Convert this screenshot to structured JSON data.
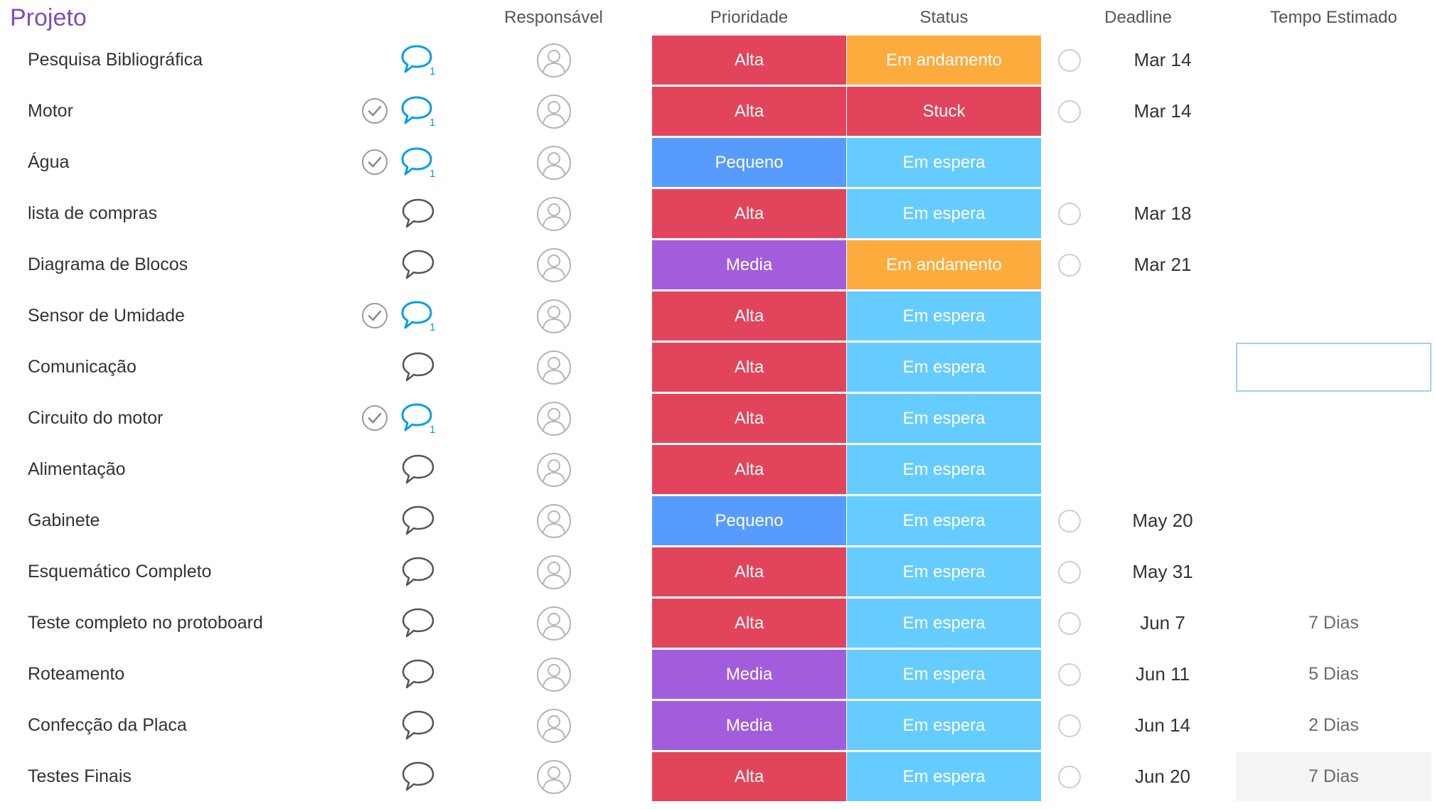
{
  "header": {
    "group_title": "Projeto",
    "columns": [
      "Responsável",
      "Prioridade",
      "Status",
      "Deadline",
      "Tempo Estimado"
    ]
  },
  "colors": {
    "alta": "#e2445c",
    "pequeno": "#579bfc",
    "media": "#a25ddc",
    "em_andamento": "#fdab3d",
    "stuck": "#e2445c",
    "em_espera": "#66ccff",
    "row_separator": "#ededed",
    "update_icon": "#0d9ee3"
  },
  "rows": [
    {
      "name": "Pesquisa Bibliográfica",
      "checked": false,
      "updates": "1",
      "priority": "Alta",
      "priority_color": "#e2445c",
      "status": "Em andamento",
      "status_color": "#fdab3d",
      "deadline": "Mar 14",
      "time": ""
    },
    {
      "name": "Motor",
      "checked": true,
      "updates": "1",
      "priority": "Alta",
      "priority_color": "#e2445c",
      "status": "Stuck",
      "status_color": "#e2445c",
      "deadline": "Mar 14",
      "time": ""
    },
    {
      "name": "Água",
      "checked": true,
      "updates": "1",
      "priority": "Pequeno",
      "priority_color": "#579bfc",
      "status": "Em espera",
      "status_color": "#66ccff",
      "deadline": "",
      "time": ""
    },
    {
      "name": "lista de compras",
      "checked": false,
      "updates": "",
      "priority": "Alta",
      "priority_color": "#e2445c",
      "status": "Em espera",
      "status_color": "#66ccff",
      "deadline": "Mar 18",
      "time": ""
    },
    {
      "name": "Diagrama de Blocos",
      "checked": false,
      "updates": "",
      "priority": "Media",
      "priority_color": "#a25ddc",
      "status": "Em andamento",
      "status_color": "#fdab3d",
      "deadline": "Mar 21",
      "time": ""
    },
    {
      "name": "Sensor de Umidade",
      "checked": true,
      "updates": "1",
      "priority": "Alta",
      "priority_color": "#e2445c",
      "status": "Em espera",
      "status_color": "#66ccff",
      "deadline": "",
      "time": ""
    },
    {
      "name": "Comunicação",
      "checked": false,
      "updates": "",
      "priority": "Alta",
      "priority_color": "#e2445c",
      "status": "Em espera",
      "status_color": "#66ccff",
      "deadline": "",
      "time": "",
      "time_selected": true
    },
    {
      "name": "Circuito do motor",
      "checked": true,
      "updates": "1",
      "priority": "Alta",
      "priority_color": "#e2445c",
      "status": "Em espera",
      "status_color": "#66ccff",
      "deadline": "",
      "time": ""
    },
    {
      "name": "Alimentação",
      "checked": false,
      "updates": "",
      "priority": "Alta",
      "priority_color": "#e2445c",
      "status": "Em espera",
      "status_color": "#66ccff",
      "deadline": "",
      "time": ""
    },
    {
      "name": "Gabinete",
      "checked": false,
      "updates": "",
      "priority": "Pequeno",
      "priority_color": "#579bfc",
      "status": "Em espera",
      "status_color": "#66ccff",
      "deadline": "May 20",
      "time": ""
    },
    {
      "name": "Esquemático Completo",
      "checked": false,
      "updates": "",
      "priority": "Alta",
      "priority_color": "#e2445c",
      "status": "Em espera",
      "status_color": "#66ccff",
      "deadline": "May 31",
      "time": ""
    },
    {
      "name": "Teste completo no protoboard",
      "checked": false,
      "updates": "",
      "priority": "Alta",
      "priority_color": "#e2445c",
      "status": "Em espera",
      "status_color": "#66ccff",
      "deadline": "Jun 7",
      "time": "7 Dias"
    },
    {
      "name": "Roteamento",
      "checked": false,
      "updates": "",
      "priority": "Media",
      "priority_color": "#a25ddc",
      "status": "Em espera",
      "status_color": "#66ccff",
      "deadline": "Jun 11",
      "time": "5 Dias"
    },
    {
      "name": "Confecção da Placa",
      "checked": false,
      "updates": "",
      "priority": "Media",
      "priority_color": "#a25ddc",
      "status": "Em espera",
      "status_color": "#66ccff",
      "deadline": "Jun 14",
      "time": "2 Dias"
    },
    {
      "name": "Testes Finais",
      "checked": false,
      "updates": "",
      "priority": "Alta",
      "priority_color": "#e2445c",
      "status": "Em espera",
      "status_color": "#66ccff",
      "deadline": "Jun 20",
      "time": "7 Dias",
      "time_shaded": true
    }
  ]
}
